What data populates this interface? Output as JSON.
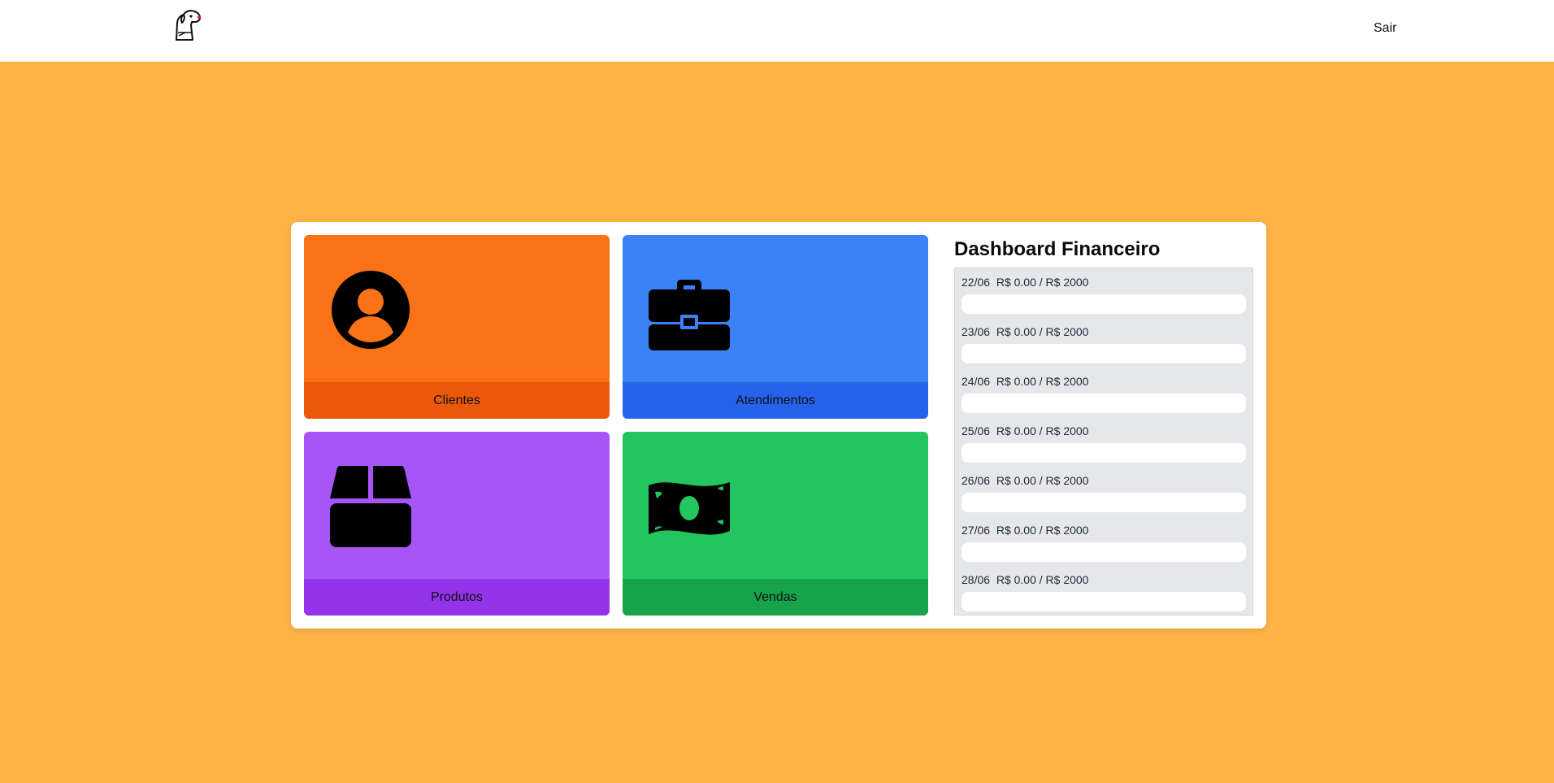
{
  "header": {
    "logout_label": "Sair",
    "logo_icon": "dog-logo-icon"
  },
  "cards": [
    {
      "label": "Clientes",
      "icon": "user-circle-icon",
      "color": "#f97316",
      "footer_color": "#ea580c"
    },
    {
      "label": "Atendimentos",
      "icon": "briefcase-icon",
      "color": "#3b82f6",
      "footer_color": "#2563eb"
    },
    {
      "label": "Produtos",
      "icon": "box-icon",
      "color": "#a855f7",
      "footer_color": "#9333ea"
    },
    {
      "label": "Vendas",
      "icon": "money-bill-icon",
      "color": "#22c55e",
      "footer_color": "#16a34a"
    }
  ],
  "dashboard": {
    "title": "Dashboard Financeiro",
    "rows": [
      {
        "date": "22/06",
        "value": "R$ 0.00 / R$ 2000",
        "progress": 0
      },
      {
        "date": "23/06",
        "value": "R$ 0.00 / R$ 2000",
        "progress": 0
      },
      {
        "date": "24/06",
        "value": "R$ 0.00 / R$ 2000",
        "progress": 0
      },
      {
        "date": "25/06",
        "value": "R$ 0.00 / R$ 2000",
        "progress": 0
      },
      {
        "date": "26/06",
        "value": "R$ 0.00 / R$ 2000",
        "progress": 0
      },
      {
        "date": "27/06",
        "value": "R$ 0.00 / R$ 2000",
        "progress": 0
      },
      {
        "date": "28/06",
        "value": "R$ 0.00 / R$ 2000",
        "progress": 0
      }
    ]
  },
  "colors": {
    "page_background": "#ffb347",
    "header_background": "#ffffff",
    "dashboard_list_background": "#e5e7eb"
  }
}
